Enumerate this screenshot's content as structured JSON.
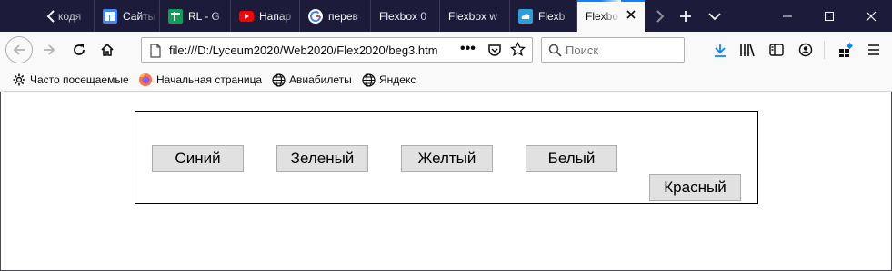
{
  "browser": {
    "tabs": [
      {
        "title": "кодя",
        "favicon": "tab-arrow-icon",
        "favicon_color": "#1c1b3a"
      },
      {
        "title": "Сайты",
        "favicon": "sites-icon",
        "favicon_color": "#4285f4"
      },
      {
        "title": "RL - G",
        "favicon": "sheets-icon",
        "favicon_color": "#0f9d58"
      },
      {
        "title": "Напар",
        "favicon": "youtube-icon",
        "favicon_color": "#ff0000"
      },
      {
        "title": "перев",
        "favicon": "google-icon",
        "favicon_color": "#ffffff"
      },
      {
        "title": "Flexbox 0",
        "favicon": "",
        "favicon_color": ""
      },
      {
        "title": "Flexbox w",
        "favicon": "",
        "favicon_color": ""
      },
      {
        "title": "Flexb",
        "favicon": "cloud-icon",
        "favicon_color": "#2d9fd8"
      },
      {
        "title": "Flexbo",
        "favicon": "",
        "favicon_color": "",
        "active": true
      }
    ],
    "window_controls": [
      "minimize",
      "maximize",
      "close"
    ]
  },
  "navbar": {
    "url": "file:///D:/Lyceum2020/Web2020/Flex2020/beg3.htm",
    "search_placeholder": "Поиск"
  },
  "bookmarks": [
    {
      "label": "Часто посещаемые",
      "icon": "gear-icon"
    },
    {
      "label": "Начальная страница",
      "icon": "firefox-icon"
    },
    {
      "label": "Авиабилеты",
      "icon": "globe-icon"
    },
    {
      "label": "Яндекс",
      "icon": "globe-icon"
    }
  ],
  "page": {
    "buttons": [
      "Синий",
      "Зеленый",
      "Желтый",
      "Белый",
      "Красный"
    ]
  },
  "colors": {
    "tabstrip": "#1c1b3a",
    "toolbar": "#f9f9fa",
    "accent": "#0a84ff",
    "page_button": "#e1e1e1"
  }
}
